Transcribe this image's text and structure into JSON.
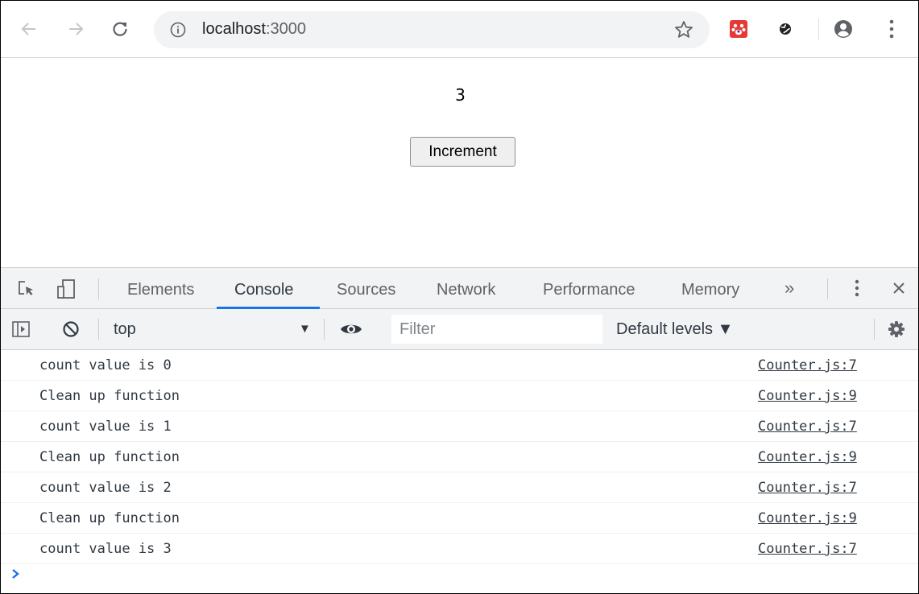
{
  "browser": {
    "url_host": "localhost",
    "url_port": ":3000"
  },
  "page": {
    "count_display": "3",
    "increment_label": "Increment"
  },
  "devtools": {
    "tabs": [
      {
        "label": "Elements",
        "active": false
      },
      {
        "label": "Console",
        "active": true
      },
      {
        "label": "Sources",
        "active": false
      },
      {
        "label": "Network",
        "active": false
      },
      {
        "label": "Performance",
        "active": false
      },
      {
        "label": "Memory",
        "active": false
      }
    ],
    "more_tabs_glyph": "»",
    "context": "top",
    "filter_placeholder": "Filter",
    "levels_label": "Default levels ▼",
    "accent_color": "#1a73e8",
    "logs": [
      {
        "message": "count value is 0",
        "source": "Counter.js:7"
      },
      {
        "message": "Clean up function",
        "source": "Counter.js:9"
      },
      {
        "message": "count value is 1",
        "source": "Counter.js:7"
      },
      {
        "message": "Clean up function",
        "source": "Counter.js:9"
      },
      {
        "message": "count value is 2",
        "source": "Counter.js:7"
      },
      {
        "message": "Clean up function",
        "source": "Counter.js:9"
      },
      {
        "message": "count value is 3",
        "source": "Counter.js:7"
      }
    ]
  }
}
